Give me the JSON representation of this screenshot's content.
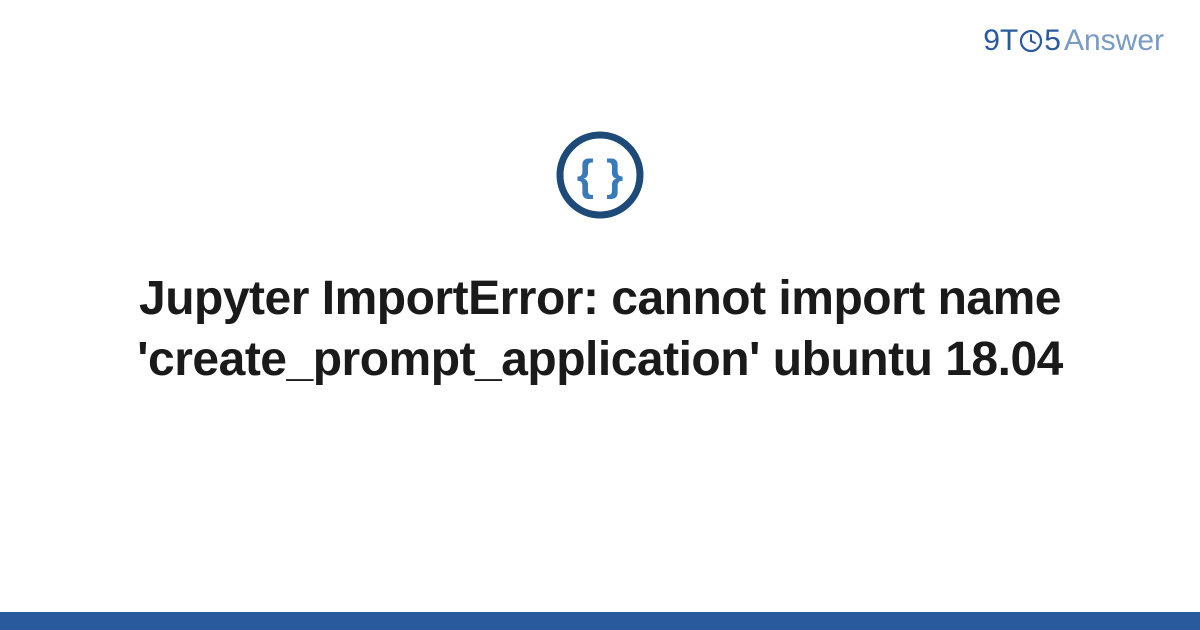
{
  "brand": {
    "prefix": "9T",
    "middle": "5",
    "suffix": "Answer"
  },
  "title": "Jupyter ImportError: cannot import name 'create_prompt_application' ubuntu 18.04",
  "colors": {
    "brand_primary": "#2a5a9e",
    "brand_secondary": "#7a9bc4",
    "text": "#1a1a1a"
  }
}
